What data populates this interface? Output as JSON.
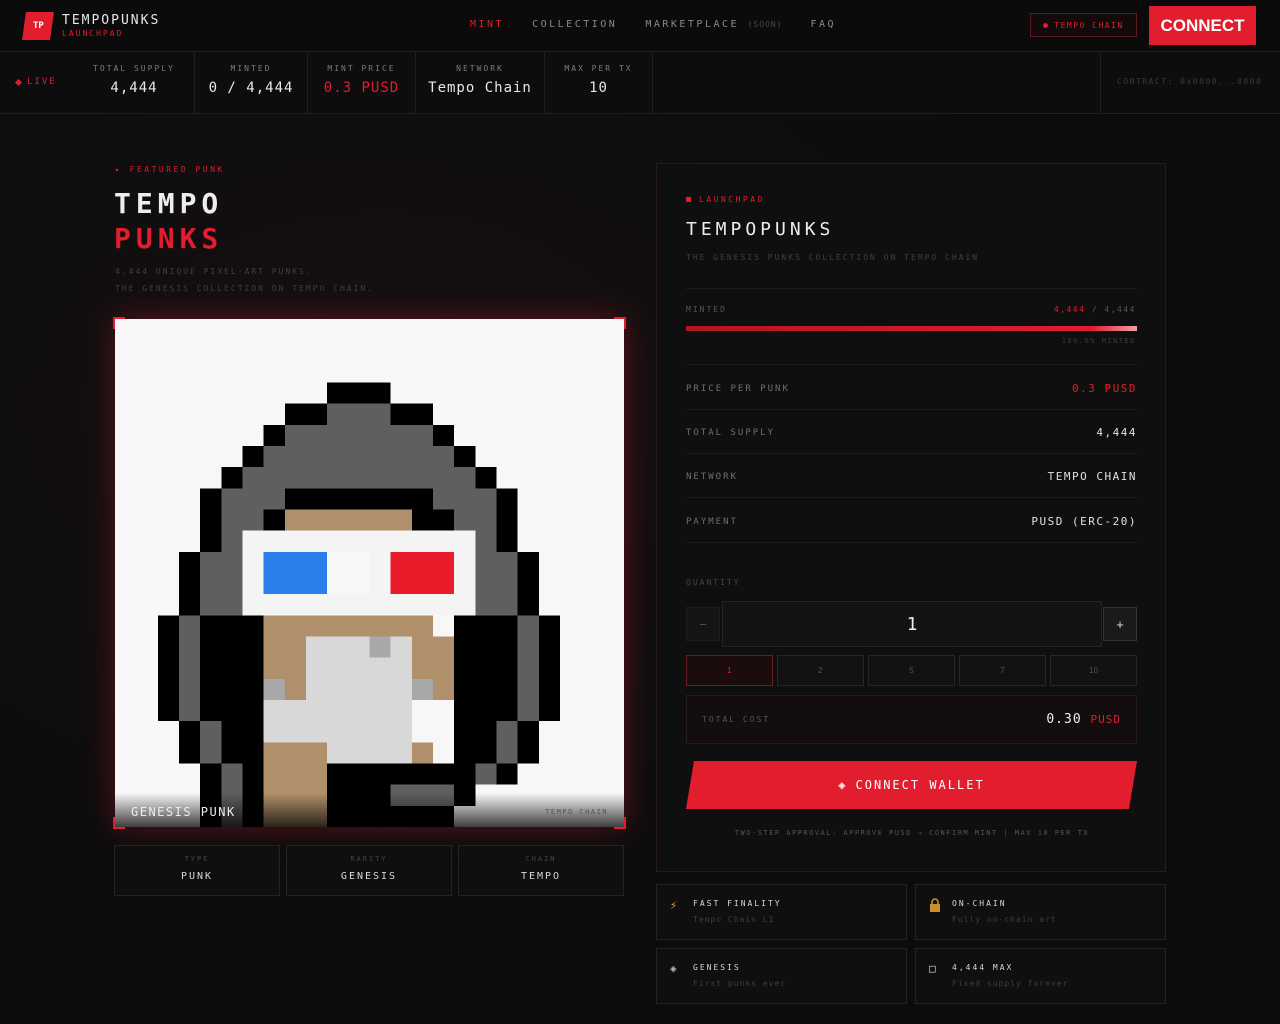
{
  "brand": {
    "logo": "TP",
    "title": "TEMPOPUNKS",
    "subtitle": "LAUNCHPAD"
  },
  "nav": {
    "links": [
      {
        "label": "MINT",
        "active": true
      },
      {
        "label": "COLLECTION",
        "active": false
      },
      {
        "label": "MARKETPLACE",
        "active": false,
        "tag": "(SOON)"
      },
      {
        "label": "FAQ",
        "active": false
      }
    ],
    "chain_badge": "TEMPO CHAIN",
    "connect_label": "CONNECT"
  },
  "stats": {
    "live_label": "LIVE",
    "items": [
      {
        "label": "TOTAL SUPPLY",
        "value": "4,444"
      },
      {
        "label": "MINTED",
        "value": "0 / 4,444"
      },
      {
        "label": "MINT PRICE",
        "value": "0.3 PUSD",
        "accent": true
      },
      {
        "label": "NETWORK",
        "value": "Tempo Chain"
      },
      {
        "label": "MAX PER TX",
        "value": "10"
      }
    ],
    "contract": "CONTRACT: 0x0000...0000"
  },
  "hero": {
    "eyebrow": "▸ FEATURED PUNK",
    "title_line1": "TEMPO",
    "title_line2": "PUNKS",
    "desc_line1": "4,444 UNIQUE PIXEL-ART PUNKS.",
    "desc_line2": "THE GENESIS COLLECTION ON TEMPO CHAIN.",
    "art_caption": "GENESIS PUNK",
    "art_tag": "TEMPO CHAIN",
    "attributes": [
      {
        "label": "TYPE",
        "value": "PUNK"
      },
      {
        "label": "RARITY",
        "value": "GENESIS"
      },
      {
        "label": "CHAIN",
        "value": "TEMPO"
      }
    ]
  },
  "panel": {
    "eyebrow": "LAUNCHPAD",
    "title": "TEMPOPUNKS",
    "subtitle": "THE GENESIS PUNKS COLLECTION ON TEMPO CHAIN",
    "minted_label": "MINTED",
    "minted_count": "4,444",
    "minted_sep": "/",
    "minted_total": "4,444",
    "minted_fraction": 1.0,
    "minted_pct": "100.0% MINTED",
    "rows": [
      {
        "label": "PRICE PER PUNK",
        "value": "0.3 PUSD",
        "accent": true
      },
      {
        "label": "TOTAL SUPPLY",
        "value": "4,444"
      },
      {
        "label": "NETWORK",
        "value": "TEMPO CHAIN"
      },
      {
        "label": "PAYMENT",
        "value": "PUSD (ERC-20)"
      }
    ],
    "quantity_label": "QUANTITY",
    "quantity_value": "1",
    "minus_label": "−",
    "plus_label": "+",
    "presets": [
      "1",
      "2",
      "5",
      "7",
      "10"
    ],
    "total_label": "TOTAL COST",
    "total_value": "0.30",
    "total_unit": "PUSD",
    "wallet_icon": "◈",
    "wallet_label": "CONNECT WALLET",
    "note": "TWO-STEP APPROVAL: APPROVE PUSD → CONFIRM MINT | MAX 10 PER TX"
  },
  "features": [
    {
      "icon": "⚡",
      "icon_name": "lightning-icon",
      "title": "FAST FINALITY",
      "sub": "Tempo Chain L1",
      "icon_color": "#e0a33a"
    },
    {
      "icon": "🔒",
      "icon_name": "lock-icon",
      "title": "ON-CHAIN",
      "sub": "Fully on-chain art",
      "icon_color": "#c8902a"
    },
    {
      "icon": "◈",
      "icon_name": "diamond-icon",
      "title": "GENESIS",
      "sub": "First punks ever",
      "icon_color": "#b8b8bc"
    },
    {
      "icon": "□",
      "icon_name": "square-icon",
      "title": "4,444 MAX",
      "sub": "Fixed supply forever",
      "icon_color": "#d8d8d8"
    }
  ],
  "colors": {
    "accent": "#e11d2e",
    "background": "#0c0c0d"
  }
}
